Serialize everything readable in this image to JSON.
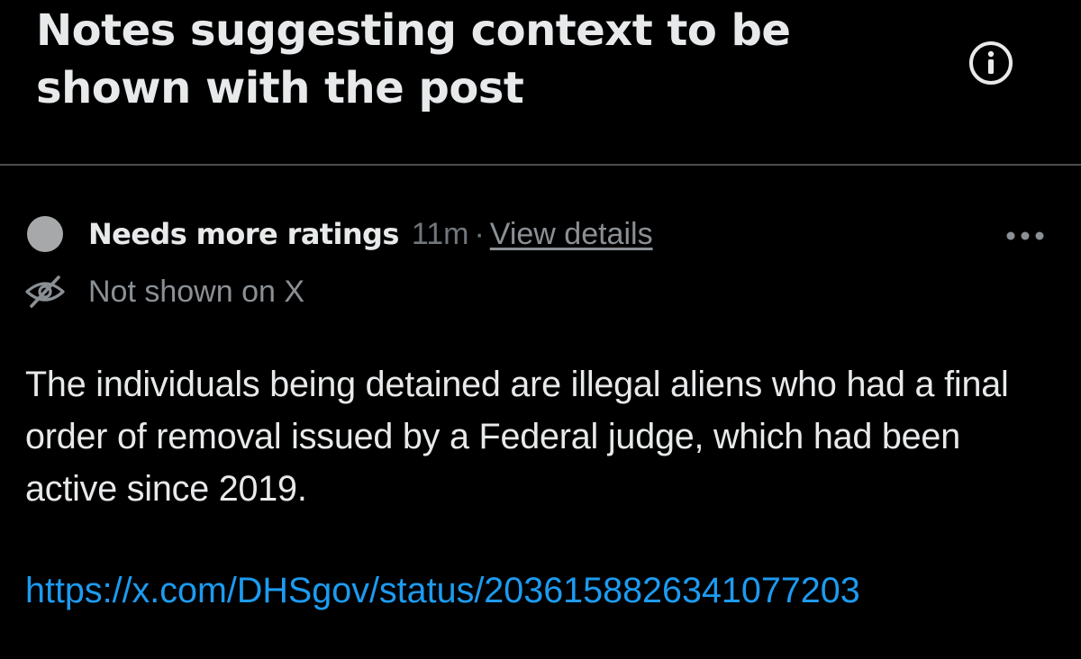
{
  "header": {
    "title": "Notes suggesting context to be shown with the post",
    "info_icon": "info-circle-icon"
  },
  "note": {
    "status_label": "Needs more ratings",
    "time": "11m",
    "separator": "·",
    "view_details_label": "View details",
    "more_icon": "more-horizontal-icon",
    "visibility_icon": "eye-slash-icon",
    "visibility_label": "Not shown on X",
    "body": "The individuals being detained are illegal aliens who had a final order of removal issued by a Federal judge, which had been active since 2019.",
    "link": "https://x.com/DHSgov/status/2036158826341077203"
  },
  "colors": {
    "background": "#000000",
    "primary_text": "#e7e9ea",
    "secondary_text": "#8b9095",
    "status_dot": "#a6a8aa",
    "link": "#1d9bf0",
    "divider": "#4a4d50"
  }
}
